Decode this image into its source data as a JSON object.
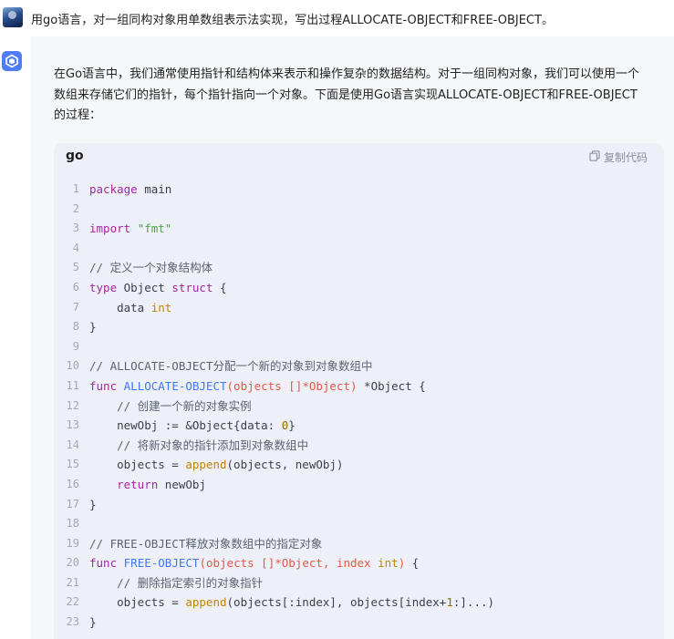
{
  "user_message": {
    "text": "用go语言，对一组同构对象用单数组表示法实现，写出过程ALLOCATE-OBJECT和FREE-OBJECT。"
  },
  "answer": {
    "intro_lines": [
      "在Go语言中，我们通常使用指针和结构体来表示和操作复杂的数据结构。对于一组同构对象，我们可以使用一个",
      "数组来存储它们的指针，每个指针指向一个对象。下面是使用Go语言实现ALLOCATE-OBJECT和FREE-OBJECT",
      "的过程："
    ]
  },
  "code_block": {
    "language": "go",
    "copy_label": "复制代码",
    "lines": [
      {
        "n": "1",
        "tokens": [
          [
            "kw",
            "package"
          ],
          [
            "pl",
            " main"
          ]
        ]
      },
      {
        "n": "2",
        "tokens": []
      },
      {
        "n": "3",
        "tokens": [
          [
            "kw",
            "import"
          ],
          [
            "pl",
            " "
          ],
          [
            "str",
            "\"fmt\""
          ]
        ]
      },
      {
        "n": "4",
        "tokens": []
      },
      {
        "n": "5",
        "tokens": [
          [
            "cm",
            "// 定义一个对象结构体"
          ]
        ]
      },
      {
        "n": "6",
        "tokens": [
          [
            "kw",
            "type"
          ],
          [
            "pl",
            " Object "
          ],
          [
            "kw",
            "struct"
          ],
          [
            "pl",
            " {"
          ]
        ]
      },
      {
        "n": "7",
        "tokens": [
          [
            "pl",
            "    data "
          ],
          [
            "ty",
            "int"
          ]
        ]
      },
      {
        "n": "8",
        "tokens": [
          [
            "pl",
            "}"
          ]
        ]
      },
      {
        "n": "9",
        "tokens": []
      },
      {
        "n": "10",
        "tokens": [
          [
            "cm",
            "// ALLOCATE-OBJECT分配一个新的对象到对象数组中"
          ]
        ]
      },
      {
        "n": "11",
        "tokens": [
          [
            "kw",
            "func"
          ],
          [
            "pl",
            " "
          ],
          [
            "fn",
            "ALLOCATE-OBJECT"
          ],
          [
            "pr",
            "(objects []*Object)"
          ],
          [
            "pl",
            " *Object {"
          ]
        ]
      },
      {
        "n": "12",
        "tokens": [
          [
            "cm",
            "    // 创建一个新的对象实例"
          ]
        ]
      },
      {
        "n": "13",
        "tokens": [
          [
            "pl",
            "    newObj := &Object{data: "
          ],
          [
            "num",
            "0"
          ],
          [
            "pl",
            "}"
          ]
        ]
      },
      {
        "n": "14",
        "tokens": [
          [
            "cm",
            "    // 将新对象的指针添加到对象数组中"
          ]
        ]
      },
      {
        "n": "15",
        "tokens": [
          [
            "pl",
            "    objects = "
          ],
          [
            "ty",
            "append"
          ],
          [
            "pl",
            "(objects, newObj)"
          ]
        ]
      },
      {
        "n": "16",
        "tokens": [
          [
            "pl",
            "    "
          ],
          [
            "kw",
            "return"
          ],
          [
            "pl",
            " newObj"
          ]
        ]
      },
      {
        "n": "17",
        "tokens": [
          [
            "pl",
            "}"
          ]
        ]
      },
      {
        "n": "18",
        "tokens": []
      },
      {
        "n": "19",
        "tokens": [
          [
            "cm",
            "// FREE-OBJECT释放对象数组中的指定对象"
          ]
        ]
      },
      {
        "n": "20",
        "tokens": [
          [
            "kw",
            "func"
          ],
          [
            "pl",
            " "
          ],
          [
            "fn",
            "FREE-OBJECT"
          ],
          [
            "pr",
            "(objects []*Object, index "
          ],
          [
            "ty",
            "int"
          ],
          [
            "pr",
            ")"
          ],
          [
            "pl",
            " {"
          ]
        ]
      },
      {
        "n": "21",
        "tokens": [
          [
            "cm",
            "    // 删除指定索引的对象指针"
          ]
        ]
      },
      {
        "n": "22",
        "tokens": [
          [
            "pl",
            "    objects = "
          ],
          [
            "ty",
            "append"
          ],
          [
            "pl",
            "(objects[:index], objects[index+"
          ],
          [
            "num",
            "1"
          ],
          [
            "pl",
            ":]...)"
          ]
        ]
      },
      {
        "n": "23",
        "tokens": [
          [
            "pl",
            "}"
          ]
        ]
      }
    ]
  },
  "icons": {
    "user_avatar": "user-avatar-image",
    "bot_avatar": "assistant-logo-icon",
    "copy": "copy-icon"
  },
  "colors": {
    "accent": "#4f7cf7",
    "keyword": "#a626a4",
    "string": "#50a14f",
    "function": "#4078f2",
    "type": "#c18401"
  }
}
